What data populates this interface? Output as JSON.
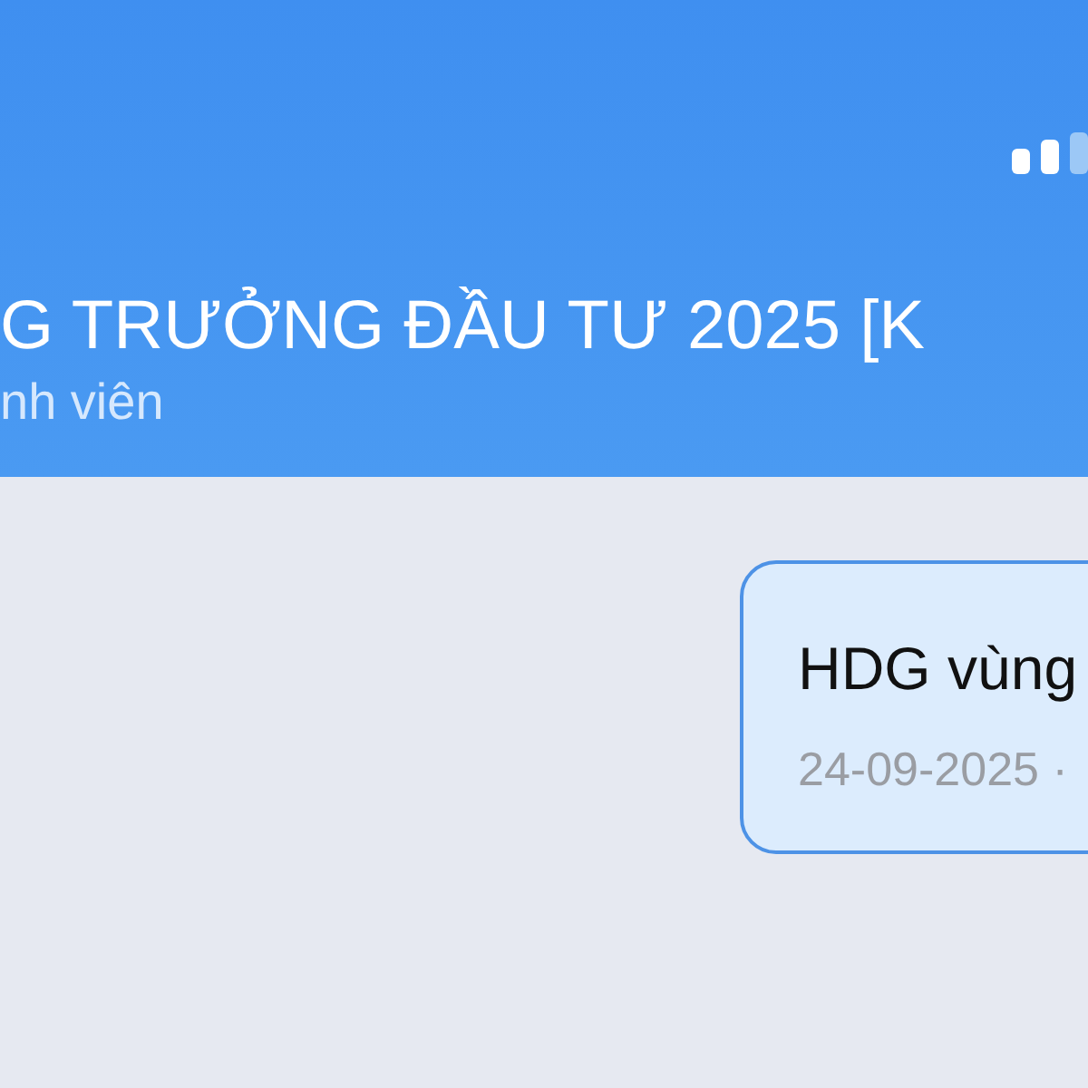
{
  "header": {
    "title": "G TRƯỞNG ĐẦU TƯ 2025 [K",
    "subtitle": "nh viên"
  },
  "messages": [
    {
      "text": "HDG vùng",
      "time": "24-09-2025 ·"
    }
  ]
}
